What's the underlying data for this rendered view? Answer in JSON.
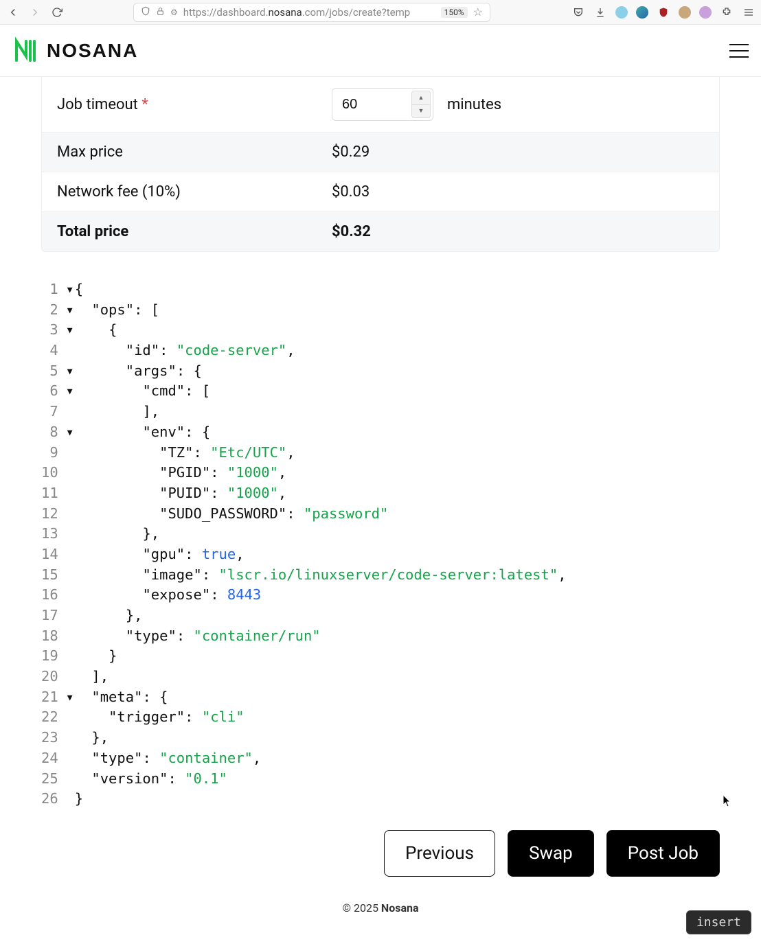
{
  "browser": {
    "url_prefix": "https://",
    "url_host_pre": "dashboard.",
    "url_host_main": "nosana",
    "url_host_post": ".com",
    "url_path": "/jobs/create?temp",
    "zoom": "150%"
  },
  "brand": {
    "name": "NOSANA"
  },
  "form": {
    "timeout_label": "Job timeout",
    "timeout_required": "*",
    "timeout_value": "60",
    "timeout_unit": "minutes",
    "max_price_label": "Max price",
    "max_price_value": "$0.29",
    "network_fee_label": "Network fee (10%)",
    "network_fee_value": "$0.03",
    "total_label": "Total price",
    "total_value": "$0.32"
  },
  "code": {
    "lines": [
      "{",
      "\"ops\": [",
      "{",
      "\"id\": \"code-server\",",
      "\"args\": {",
      "\"cmd\": [",
      "],",
      "\"env\": {",
      "\"TZ\": \"Etc/UTC\",",
      "\"PGID\": \"1000\",",
      "\"PUID\": \"1000\",",
      "\"SUDO_PASSWORD\": \"password\"",
      "},",
      "\"gpu\": true,",
      "\"image\": \"lscr.io/linuxserver/code-server:latest\",",
      "\"expose\": 8443",
      "},",
      "\"type\": \"container/run\"",
      "}",
      "],",
      "\"meta\": {",
      "\"trigger\": \"cli\"",
      "},",
      "\"type\": \"container\",",
      "\"version\": \"0.1\"",
      "}"
    ]
  },
  "buttons": {
    "previous": "Previous",
    "swap": "Swap",
    "post": "Post Job"
  },
  "footer": {
    "copyright_pre": "© 2025 ",
    "copyright_brand": "Nosana"
  },
  "vim": {
    "mode": "insert"
  }
}
